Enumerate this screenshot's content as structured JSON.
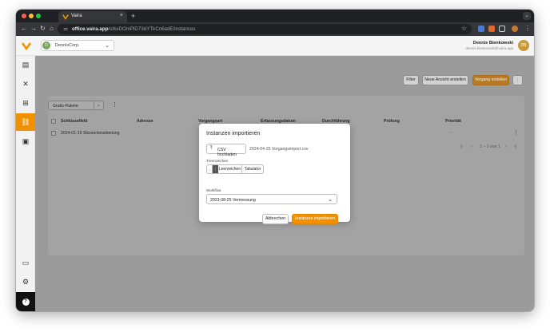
{
  "browser": {
    "tab_title": "Vaira",
    "tab_close": "×",
    "new_tab": "+",
    "tab_menu": "⌄",
    "url_host": "office.vaira.app",
    "url_path": "/o/kxDOmPlD73dYTkCn6adE/instances",
    "nav": {
      "back": "←",
      "forward": "→",
      "reload": "↻",
      "home": "⌂"
    },
    "star": "☆",
    "colors": {
      "close": "#ff5f57",
      "minimize": "#febc2e",
      "maximize": "#28c840"
    }
  },
  "header": {
    "org_badge": "D",
    "org_name": "DennisCorp.",
    "org_chevron": "⌄",
    "user_name": "Dennis Bienkowski",
    "user_email": "dennis.bienkowski@vaira.app",
    "avatar_initials": "DB"
  },
  "sidebar": {
    "items": [
      {
        "icon": "folder-icon",
        "glyph": "▤"
      },
      {
        "icon": "wrench-icon",
        "glyph": "✕"
      },
      {
        "icon": "hierarchy-icon",
        "glyph": "⊞"
      },
      {
        "icon": "link-icon",
        "glyph": "⛓"
      },
      {
        "icon": "contact-icon",
        "glyph": "▣"
      }
    ],
    "bottom_items": [
      {
        "icon": "inbox-icon",
        "glyph": "▭"
      },
      {
        "icon": "gear-icon",
        "glyph": "⚙"
      }
    ],
    "help": "?"
  },
  "toolbar": {
    "filter": "Filter",
    "new_view": "Neue Ansicht erstellen",
    "create": "Vorgang erstellen",
    "more": "⋮"
  },
  "table": {
    "package_select": "Gratis-Pakete",
    "package_chevron": "⌄",
    "columns": [
      "Schlüsselfeld",
      "Adresse",
      "Vorgangsart",
      "Erfassungsdatum",
      "Durchführung",
      "Prüfung",
      "Priorität"
    ],
    "rows": [
      {
        "key": "2024-01-19 Skizzenbearbeitung",
        "priority": "→"
      }
    ],
    "row_menu": "⋮",
    "pagination": {
      "first": "|‹",
      "prev": "‹",
      "label": "1 – 1 von 1",
      "next": "›",
      "last": "›|"
    }
  },
  "modal": {
    "title": "Instanzen importieren",
    "upload_icon": "⤒",
    "upload_label": "CSV hochladen",
    "file_name": "2024-04-25 Vorgangsimport.csv",
    "separator_label": "Trennzeichen",
    "separators": [
      ",",
      ";",
      "Leerzeichen",
      "Tabulator"
    ],
    "workflow_label": "Workflow",
    "workflow_value": "2023-08-25 Vermessung",
    "workflow_chevron": "⌄",
    "cancel": "Abbrechen",
    "submit": "Instanzen importieren"
  }
}
